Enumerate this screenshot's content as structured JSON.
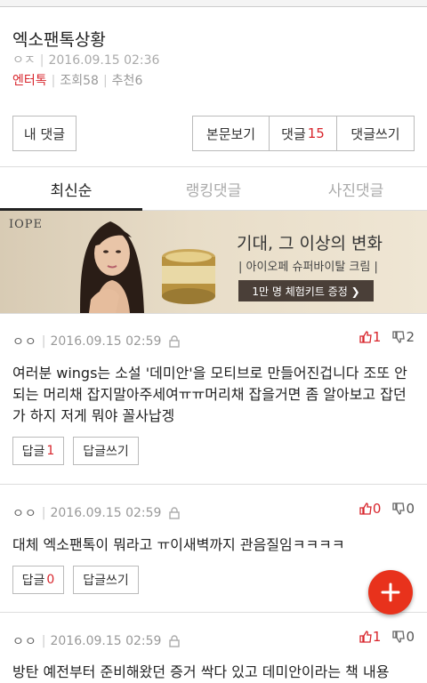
{
  "post": {
    "title": "엑소팬톡상황",
    "author": "ㅇㅈ",
    "date": "2016.09.15 02:36",
    "category": "엔터톡",
    "views_label": "조회",
    "views": "58",
    "recommend_label": "추천",
    "recommends": "6"
  },
  "actions": {
    "my_comments": "내 댓글",
    "view_post": "본문보기",
    "comments_label": "댓글",
    "comments_count": "15",
    "write_comment": "댓글쓰기"
  },
  "tabs": [
    {
      "label": "최신순",
      "active": true
    },
    {
      "label": "랭킹댓글",
      "active": false
    },
    {
      "label": "사진댓글",
      "active": false
    }
  ],
  "ad": {
    "brand": "IOPE",
    "headline": "기대, 그 이상의 변화",
    "subline": "| 아이오페 슈퍼바이탈 크림 |",
    "cta": "1만 명 체험키트 증정 ❯"
  },
  "comments": [
    {
      "author": "ㅇㅇ",
      "date": "2016.09.15 02:59",
      "up": "1",
      "down": "2",
      "body": "여러분 wings는 소설 '데미안'을 모티브로 만들어진겁니다 조또 안되는 머리채 잡지말아주세여ㅠㅠ머리채 잡을거면 좀 알아보고 잡던가 하지 저게 뭐야 꼴사납겡",
      "reply_label": "답글",
      "reply_count": "1",
      "write_reply": "답글쓰기"
    },
    {
      "author": "ㅇㅇ",
      "date": "2016.09.15 02:59",
      "up": "0",
      "down": "0",
      "body": "대체 엑소팬톡이 뭐라고 ㅠ이새벽까지 관음질임ㅋㅋㅋㅋ",
      "reply_label": "답글",
      "reply_count": "0",
      "write_reply": "답글쓰기"
    },
    {
      "author": "ㅇㅇ",
      "date": "2016.09.15 02:59",
      "up": "1",
      "down": "0",
      "body": "방탄 예전부터 준비해왔던 증거 싹다 있고 데미안이라는 책 내용"
    }
  ],
  "colors": {
    "accent": "#d8262d",
    "fab": "#e8321c"
  },
  "icons": {
    "fab": "plus-icon",
    "lock": "lock-icon",
    "up": "thumbs-up-icon",
    "down": "thumbs-down-icon"
  }
}
